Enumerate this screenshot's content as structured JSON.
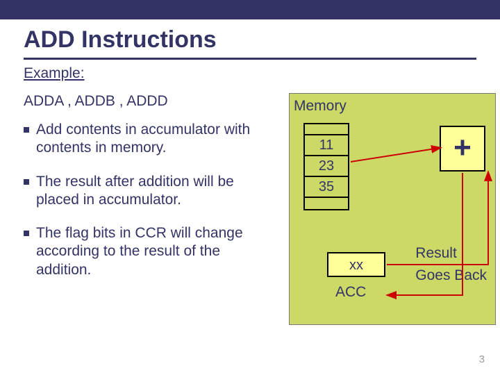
{
  "title": "ADD  Instructions",
  "example_label": "Example:",
  "instructions_line": "ADDA , ADDB , ADDD",
  "bullets": [
    "Add contents in accumulator with contents in memory.",
    "The result after addition will be placed in accumulator.",
    "The flag bits in CCR will change according to the result of the addition."
  ],
  "diagram": {
    "memory_label": "Memory",
    "memory_values": [
      "11",
      "23",
      "35"
    ],
    "plus_symbol": "+",
    "acc_value": "xx",
    "acc_label": "ACC",
    "result_line1": "Result",
    "result_line2": "Goes Back"
  },
  "page_number": "3",
  "colors": {
    "primary": "#333366",
    "diagram_bg": "#ccd966",
    "box_bg": "#ffff99"
  }
}
